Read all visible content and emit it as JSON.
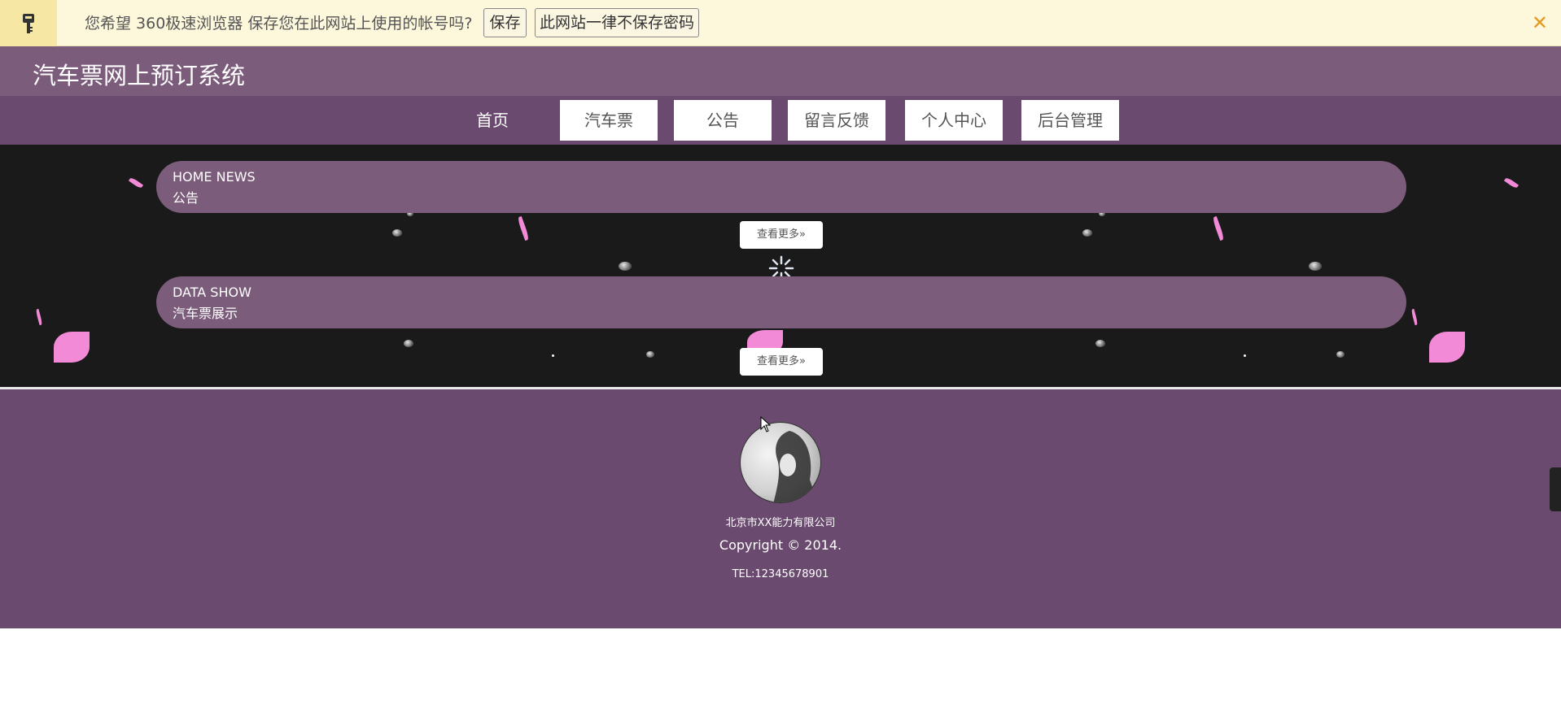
{
  "password_bar": {
    "message": "您希望 360极速浏览器 保存您在此网站上使用的帐号吗?",
    "save_label": "保存",
    "never_label": "此网站一律不保存密码",
    "close_symbol": "✕",
    "key_icon": "key-icon"
  },
  "header": {
    "title": "汽车票网上预订系统"
  },
  "nav": {
    "items": [
      {
        "label": "首页"
      },
      {
        "label": "汽车票"
      },
      {
        "label": "公告"
      },
      {
        "label": "留言反馈"
      },
      {
        "label": "个人中心"
      },
      {
        "label": "后台管理"
      }
    ]
  },
  "sections": [
    {
      "en": "HOME NEWS",
      "zh": "公告",
      "more": "查看更多»"
    },
    {
      "en": "DATA SHOW",
      "zh": "汽车票展示",
      "more": "查看更多»"
    }
  ],
  "footer": {
    "company": "北京市XX能力有限公司",
    "copyright": "Copyright © 2014.",
    "tel": "TEL:12345678901"
  },
  "colors": {
    "accent": "#7b5c7b",
    "nav_bg": "#6a4a6e",
    "main_bg": "#1a1a1a",
    "bar_bg": "#fdf7dc",
    "close": "#e39a1e",
    "petal": "#f28ad8"
  }
}
